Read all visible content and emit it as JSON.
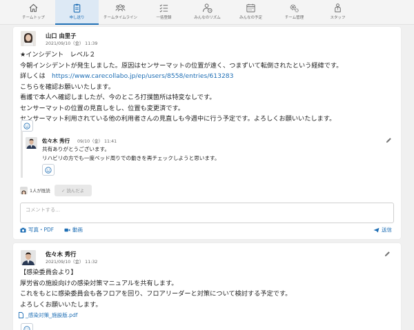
{
  "nav": {
    "items": [
      {
        "label": "チームトップ",
        "icon": "home-icon"
      },
      {
        "label": "申し送り",
        "icon": "clipboard-icon",
        "active": true
      },
      {
        "label": "チームタイムライン",
        "icon": "team-icon"
      },
      {
        "label": "一括登録",
        "icon": "checklist-icon"
      },
      {
        "label": "みんなのリズム",
        "icon": "user-clock-icon"
      },
      {
        "label": "みんなの予定",
        "icon": "calendar-icon"
      },
      {
        "label": "チーム管理",
        "icon": "gears-icon"
      },
      {
        "label": "スタッフ",
        "icon": "staff-icon"
      }
    ],
    "active_color": "#1f6fb5"
  },
  "post1": {
    "author": "山口 由里子",
    "timestamp": "2021/09/10（金） 11:39",
    "lines": [
      "★インシデント　レベル２",
      "今朝インシデントが発生しました。原因はセンサーマットの位置が遠く、つまずいて転倒されたという経緯です。",
      "詳しくは",
      "こちらを確認お願いいたします。",
      "看護で本人へ確認しましたが、今のところ打撲箇所は特変なしです。",
      "センサーマットの位置の見直しをし、位置も変更済です。",
      "センサーマット利用されている他の利用者さんの見直しも今週中に行う予定です。よろしくお願いいたします。"
    ],
    "link": "https://www.carecollabo.jp/ep/users/8558/entries/613283",
    "reply": {
      "author": "佐々木 秀行",
      "timestamp": "09/10（金） 11:41",
      "lines": [
        "共有ありがとうございます。",
        "リハビリの方でも一度ベッド周りでの動きを再チェックしようと思います。"
      ]
    },
    "readers_text": "1人が既読",
    "read_button": "✓ 読んだよ",
    "comment_placeholder": "コメントする...",
    "attach_photo": "写真・PDF",
    "attach_video": "動画",
    "send": "送信"
  },
  "post2": {
    "author": "佐々木 秀行",
    "timestamp": "2021/09/10（金） 11:32",
    "lines": [
      "【感染委員会より】",
      "厚労省の施設向けの感染対策マニュアルを共有します。",
      "これをもとに感染委員会も各フロアを回り、フロアリーダーと対策について検討する予定です。",
      "よろしくお願いいたします。"
    ],
    "file": "_感染対策_施設版.pdf"
  }
}
